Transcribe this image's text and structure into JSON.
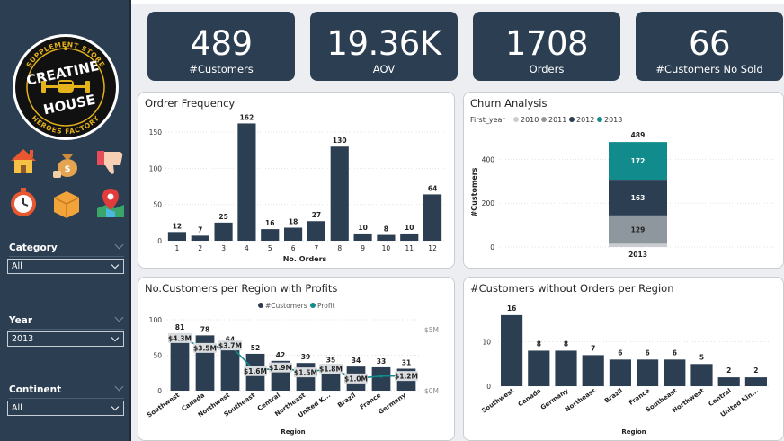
{
  "sidebar": {
    "logo": {
      "top_text": "SUPPLEMENT STORE",
      "brand_line1": "CREATINE",
      "brand_line2": "HOUSE",
      "bottom_text": "HEROES FACTORY"
    },
    "nav_icons": [
      "home-icon",
      "money-bag-icon",
      "thumbs-down-icon",
      "stopwatch-icon",
      "package-box-icon",
      "map-pin-icon"
    ],
    "filters": [
      {
        "label": "Category",
        "value": "All"
      },
      {
        "label": "Year",
        "value": "2013"
      },
      {
        "label": "Continent",
        "value": "All"
      }
    ]
  },
  "kpis": [
    {
      "value": "489",
      "label": "#Customers"
    },
    {
      "value": "19.36K",
      "label": "AOV"
    },
    {
      "value": "1708",
      "label": "Orders"
    },
    {
      "value": "66",
      "label": "#Customers No Sold"
    }
  ],
  "colors": {
    "navy": "#2c3e52",
    "teal": "#118b8b",
    "gray": "#8e979e",
    "light_gray": "#c9cdd1",
    "bg": "#eceef1"
  },
  "chart_data": [
    {
      "id": "order-frequency",
      "type": "bar",
      "title": "Ordrer Frequency",
      "xlabel": "No. Orders",
      "ylabel": "",
      "categories": [
        "1",
        "2",
        "3",
        "4",
        "5",
        "6",
        "7",
        "8",
        "9",
        "10",
        "11",
        "12"
      ],
      "values": [
        12,
        7,
        25,
        162,
        16,
        18,
        27,
        130,
        10,
        8,
        10,
        64
      ],
      "ylim": [
        0,
        170
      ],
      "yticks": [
        0,
        50,
        100,
        150
      ],
      "grid": true
    },
    {
      "id": "churn-analysis",
      "type": "bar",
      "stacked": true,
      "title": "Churn Analysis",
      "legend_title": "First_year",
      "legend_position": "top-left",
      "ylabel": "#Customers",
      "categories": [
        "2013"
      ],
      "series": [
        {
          "name": "2010",
          "values": [
            15
          ],
          "color": "#c9cdd1"
        },
        {
          "name": "2011",
          "values": [
            129
          ],
          "color": "#8e979e"
        },
        {
          "name": "2012",
          "values": [
            163
          ],
          "color": "#2c3e52"
        },
        {
          "name": "2013",
          "values": [
            172
          ],
          "color": "#118b8b"
        }
      ],
      "total_label": "489",
      "ylim": [
        0,
        500
      ],
      "yticks": [
        0,
        200,
        400
      ],
      "grid": true
    },
    {
      "id": "customers-per-region",
      "type": "bar",
      "title": "No.Customers per Region with Profits",
      "legend_position": "top",
      "xlabel": "Region",
      "categories": [
        "Southwest",
        "Canada",
        "Northwest",
        "Southeast",
        "Central",
        "Northeast",
        "United K...",
        "Brazil",
        "France",
        "Germany"
      ],
      "series": [
        {
          "name": "#Customers",
          "kind": "bar",
          "values": [
            81,
            78,
            64,
            52,
            42,
            39,
            35,
            34,
            33,
            31
          ],
          "color": "#2c3e52"
        },
        {
          "name": "Profit",
          "kind": "line",
          "values": [
            4.3,
            3.5,
            3.7,
            1.6,
            1.9,
            1.5,
            1.8,
            1.0,
            1.2,
            1.2
          ],
          "labels": [
            "$4.3M",
            "$3.5M",
            "$3.7M",
            "$1.6M",
            "$1.9M",
            "$1.5M",
            "$1.8M",
            "$1.0M",
            "",
            "$1.2M"
          ],
          "color": "#118b8b"
        }
      ],
      "ylim": [
        0,
        100
      ],
      "yticks": [
        0,
        50,
        100
      ],
      "y2lim": [
        0,
        5.8
      ],
      "y2ticks": [
        {
          "v": 0,
          "label": "$0M"
        },
        {
          "v": 5,
          "label": "$5M"
        }
      ],
      "grid": true
    },
    {
      "id": "customers-without-orders",
      "type": "bar",
      "title": "#Customers without Orders per Region",
      "xlabel": "Region",
      "categories": [
        "Southwest",
        "Canada",
        "Germany",
        "Northeast",
        "Brazil",
        "France",
        "Southeast",
        "Northwest",
        "Central",
        "United Kin..."
      ],
      "values": [
        16,
        8,
        8,
        7,
        6,
        6,
        6,
        5,
        2,
        2
      ],
      "ylim": [
        0,
        18
      ],
      "yticks": [
        0,
        10
      ],
      "grid": true
    }
  ]
}
